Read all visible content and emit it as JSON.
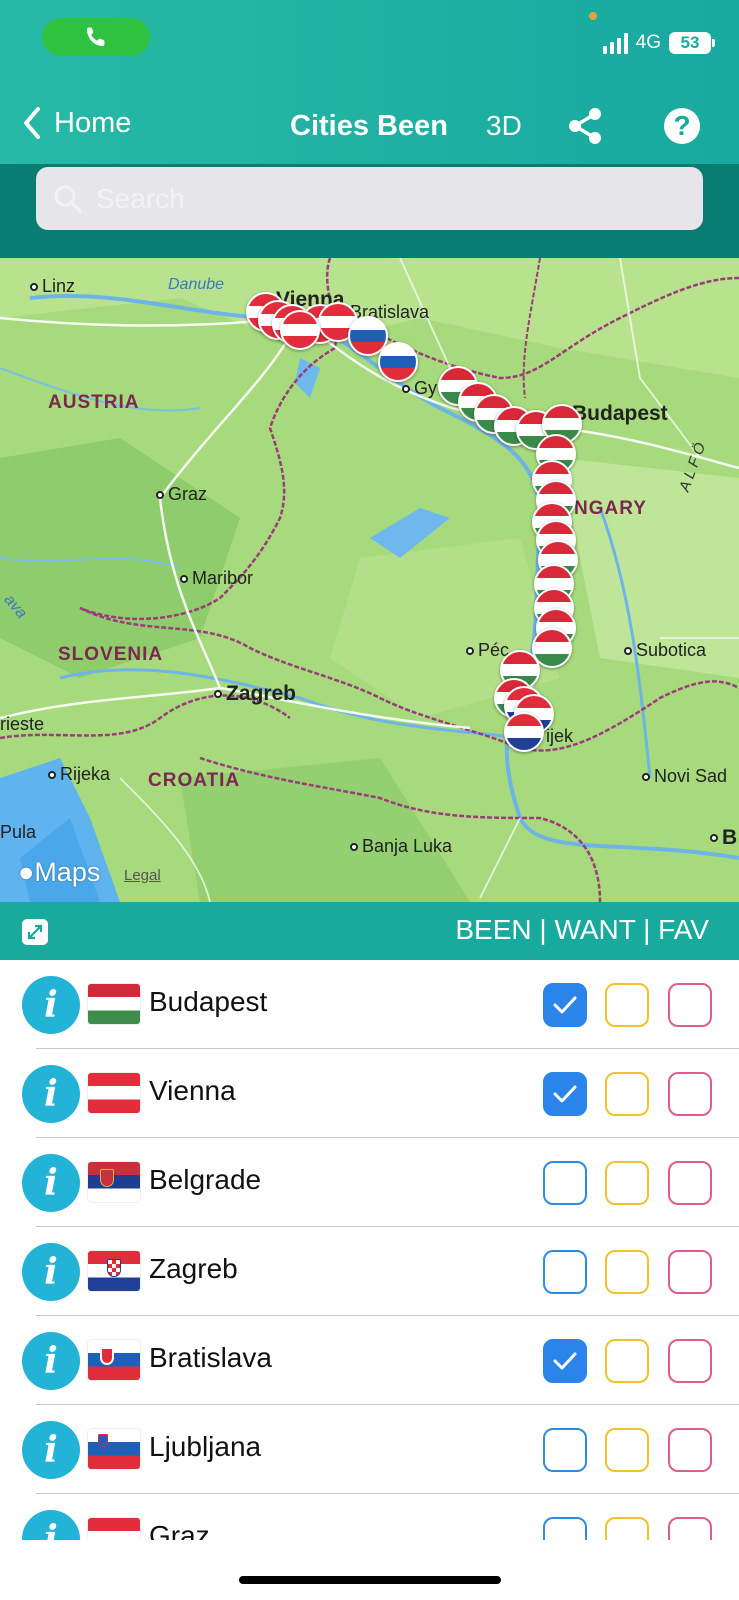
{
  "colors": {
    "header": "#1aaf9f",
    "header_dark": "#0a7d72",
    "been": "#2b84ea",
    "want": "#f1c22e",
    "fav": "#e05c8f",
    "info": "#23b3d6"
  },
  "status_bar": {
    "network": "4G",
    "battery": "53",
    "call_icon": "phone-icon"
  },
  "nav": {
    "back_label": "Home",
    "title": "Cities Been",
    "mode_3d": "3D",
    "share_icon": "share-icon",
    "help_label": "?"
  },
  "search": {
    "placeholder": "Search"
  },
  "map": {
    "attribution": "Maps",
    "legal": "Legal",
    "labels": {
      "linz": "Linz",
      "danube": "Danube",
      "vienna": "Vienna",
      "bratislava": "Bratislava",
      "austria": "AUSTRIA",
      "gyor": "Gy",
      "budapest": "Budapest",
      "graz": "Graz",
      "hungary": "NGARY",
      "maribor": "Maribor",
      "slovenia": "SLOVENIA",
      "pecs": "Péc",
      "subotica": "Subotica",
      "zagreb": "Zagreb",
      "trieste": "rieste",
      "osijek": "ijek",
      "rijeka": "Rijeka",
      "croatia": "CROATIA",
      "novisad": "Novi Sad",
      "pula": "Pula",
      "banjaluka": "Banja Luka",
      "alfold": "A L F Ö",
      "b": "B",
      "sava": "ava"
    }
  },
  "list_header": {
    "columns": "BEEN | WANT | FAV",
    "expand_icon": "expand-icon"
  },
  "cities": [
    {
      "name": "Budapest",
      "flag": "hu",
      "been": true,
      "want": false,
      "fav": false
    },
    {
      "name": "Vienna",
      "flag": "at",
      "been": true,
      "want": false,
      "fav": false
    },
    {
      "name": "Belgrade",
      "flag": "rs",
      "been": false,
      "want": false,
      "fav": false
    },
    {
      "name": "Zagreb",
      "flag": "hr",
      "been": false,
      "want": false,
      "fav": false
    },
    {
      "name": "Bratislava",
      "flag": "sk",
      "been": true,
      "want": false,
      "fav": false
    },
    {
      "name": "Ljubljana",
      "flag": "si",
      "been": false,
      "want": false,
      "fav": false
    },
    {
      "name": "Graz",
      "flag": "at",
      "been": false,
      "want": false,
      "fav": false
    }
  ]
}
